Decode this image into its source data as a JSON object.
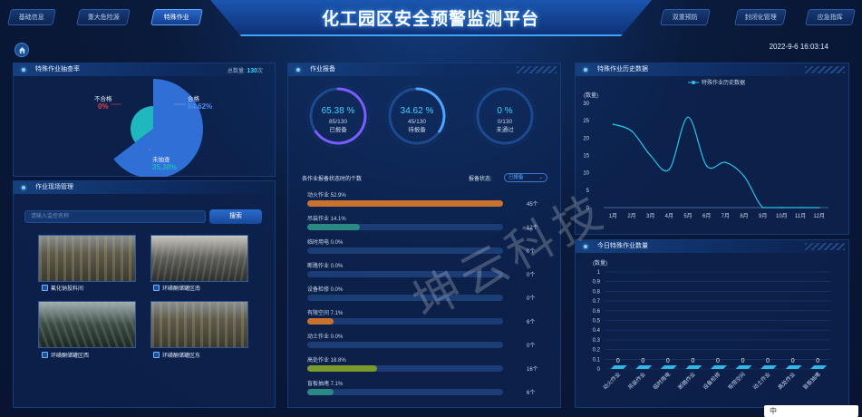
{
  "header": {
    "title": "化工园区安全预警监测平台",
    "nav_left": [
      "基础信息",
      "重大危险源",
      "特殊作业"
    ],
    "nav_right": [
      "双重预防",
      "封闭化管理",
      "应急指挥"
    ],
    "datetime": "2022-9-6 16:03:14"
  },
  "pass_rate": {
    "title": "特殊作业抽查率",
    "total_label": "总数量:",
    "total_value": "130",
    "total_unit": "次",
    "slices": [
      {
        "name": "合格",
        "percent": "64.62%",
        "value": 64.62,
        "color": "#2f6fd6"
      },
      {
        "name": "不合格",
        "percent": "0%",
        "value": 0,
        "color": "#e0404a"
      },
      {
        "name": "未抽查",
        "percent": "35.38%",
        "value": 35.38,
        "color": "#1fb8bf"
      }
    ]
  },
  "site": {
    "title": "作业现场管理",
    "search_placeholder": "请输入监控名称",
    "search_button": "搜索",
    "cameras": [
      "氟化钠投料间",
      "环磺酮储罐区南",
      "环磺酮储罐区西",
      "环磺酮储罐区东"
    ]
  },
  "report": {
    "title": "作业报备",
    "gauges": [
      {
        "percent": "65.38 %",
        "ratio": "85/130",
        "label": "已报备",
        "value": 65.38,
        "color": "#4ea5ff"
      },
      {
        "percent": "34.62 %",
        "ratio": "45/130",
        "label": "待报备",
        "value": 34.62,
        "color": "#4ea5ff"
      },
      {
        "percent": "0 %",
        "ratio": "0/130",
        "label": "未通过",
        "value": 0,
        "color": "#4ea5ff"
      }
    ],
    "subtitle": "各作业报备状态时的个数",
    "status_label": "报备状态:",
    "status_value": "已报备",
    "items": [
      {
        "label": "动火作业 52.9%",
        "value": 52.9,
        "count": "45个",
        "color": "#c9712f"
      },
      {
        "label": "吊装作业 14.1%",
        "value": 14.1,
        "count": "12个",
        "color": "#2a8a83"
      },
      {
        "label": "临时用电 0.0%",
        "value": 0,
        "count": "0个",
        "color": "#4a7bd0"
      },
      {
        "label": "断路作业 0.0%",
        "value": 0,
        "count": "0个",
        "color": "#4a7bd0"
      },
      {
        "label": "设备检修 0.0%",
        "value": 0,
        "count": "0个",
        "color": "#4a7bd0"
      },
      {
        "label": "有限空间 7.1%",
        "value": 7.1,
        "count": "6个",
        "color": "#c9712f"
      },
      {
        "label": "动土作业 0.0%",
        "value": 0,
        "count": "0个",
        "color": "#4a7bd0"
      },
      {
        "label": "高处作业 18.8%",
        "value": 18.8,
        "count": "16个",
        "color": "#7a9a2c"
      },
      {
        "label": "盲板抽堵 7.1%",
        "value": 7.1,
        "count": "6个",
        "color": "#2a8a83"
      }
    ]
  },
  "history": {
    "title": "特殊作业历史数据",
    "chart_data": {
      "type": "line",
      "ylabel": "(数量)",
      "legend": "特殊作业历史数据",
      "legend_position": "top-center",
      "categories": [
        "1月",
        "2月",
        "3月",
        "4月",
        "5月",
        "6月",
        "7月",
        "8月",
        "9月",
        "10月",
        "11月",
        "12月"
      ],
      "values": [
        24,
        22,
        15,
        11,
        26,
        12,
        13,
        9,
        0,
        0,
        0,
        0
      ],
      "ylim": [
        0,
        30
      ],
      "yticks": [
        0,
        5,
        10,
        15,
        20,
        25,
        30
      ],
      "color": "#29c4e8"
    }
  },
  "today": {
    "title": "今日特殊作业数量",
    "chart_data": {
      "type": "bar",
      "ylabel": "(数量)",
      "categories": [
        "动火作业",
        "吊装作业",
        "临时用电",
        "断路作业",
        "设备检修",
        "有限空间",
        "动土作业",
        "高处作业",
        "盲板抽堵"
      ],
      "values": [
        0,
        0,
        0,
        0,
        0,
        0,
        0,
        0,
        0
      ],
      "ylim": [
        0,
        1
      ],
      "yticks": [
        0,
        0.1,
        0.2,
        0.3,
        0.4,
        0.5,
        0.6,
        0.7,
        0.8,
        0.9,
        1
      ],
      "color": "#2fb7e6"
    }
  },
  "watermark": "坤云科技",
  "ime": "中"
}
